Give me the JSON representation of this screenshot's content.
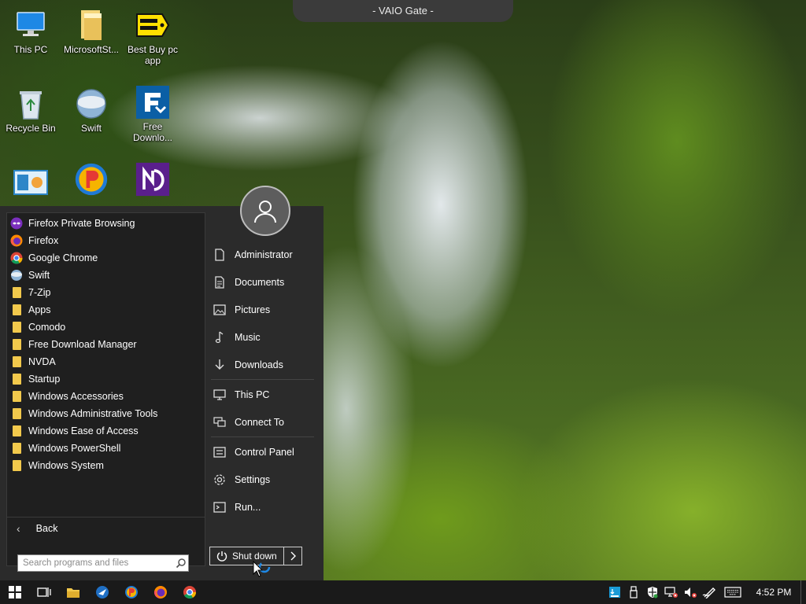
{
  "window": {
    "title": "- VAIO Gate -"
  },
  "desktop": {
    "icons": [
      {
        "label": "This PC"
      },
      {
        "label": "MicrosoftSt..."
      },
      {
        "label": "Best Buy pc app"
      },
      {
        "label": "Recycle Bin"
      },
      {
        "label": "Swift"
      },
      {
        "label": "Free Downlo..."
      },
      {
        "label": ""
      },
      {
        "label": ""
      },
      {
        "label": ""
      }
    ]
  },
  "start_menu": {
    "apps": [
      {
        "label": "Firefox Private Browsing",
        "icon": "firefox-private-icon"
      },
      {
        "label": "Firefox",
        "icon": "firefox-icon"
      },
      {
        "label": "Google Chrome",
        "icon": "chrome-icon"
      },
      {
        "label": "Swift",
        "icon": "swift-icon"
      },
      {
        "label": "7-Zip",
        "icon": "folder-icon"
      },
      {
        "label": "Apps",
        "icon": "folder-icon"
      },
      {
        "label": "Comodo",
        "icon": "folder-icon"
      },
      {
        "label": "Free Download Manager",
        "icon": "folder-icon"
      },
      {
        "label": "NVDA",
        "icon": "folder-icon"
      },
      {
        "label": "Startup",
        "icon": "folder-icon"
      },
      {
        "label": "Windows Accessories",
        "icon": "folder-icon"
      },
      {
        "label": "Windows Administrative Tools",
        "icon": "folder-icon"
      },
      {
        "label": "Windows Ease of Access",
        "icon": "folder-icon"
      },
      {
        "label": "Windows PowerShell",
        "icon": "folder-icon"
      },
      {
        "label": "Windows System",
        "icon": "folder-icon"
      }
    ],
    "back_label": "Back",
    "search_placeholder": "Search programs and files",
    "right_items": [
      {
        "label": "Administrator",
        "icon": "user-folder-icon"
      },
      {
        "label": "Documents",
        "icon": "documents-icon"
      },
      {
        "label": "Pictures",
        "icon": "pictures-icon"
      },
      {
        "label": "Music",
        "icon": "music-icon"
      },
      {
        "label": "Downloads",
        "icon": "downloads-icon"
      },
      {
        "label": "This PC",
        "icon": "computer-icon"
      },
      {
        "label": "Connect To",
        "icon": "connect-icon"
      },
      {
        "label": "Control Panel",
        "icon": "control-panel-icon"
      },
      {
        "label": "Settings",
        "icon": "gear-icon"
      },
      {
        "label": "Run...",
        "icon": "run-icon"
      }
    ],
    "shutdown_label": "Shut down"
  },
  "taskbar": {
    "clock": "4:52 PM"
  },
  "colors": {
    "accent": "#f2c94c",
    "menu_bg": "#2b2b2b",
    "list_bg": "#1f1f1f",
    "taskbar_bg": "#1a1a1a"
  }
}
